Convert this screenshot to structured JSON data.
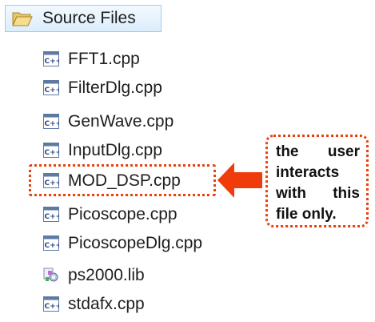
{
  "tree": {
    "folder": {
      "label": "Source Files",
      "icon": "open-folder-icon"
    },
    "files": [
      {
        "label": "FFT1.cpp",
        "icon": "cpp-file-icon"
      },
      {
        "label": "FilterDlg.cpp",
        "icon": "cpp-file-icon"
      },
      {
        "label": "GenWave.cpp",
        "icon": "cpp-file-icon"
      },
      {
        "label": "InputDlg.cpp",
        "icon": "cpp-file-icon"
      },
      {
        "label": "MOD_DSP.cpp",
        "icon": "cpp-file-icon"
      },
      {
        "label": "Picoscope.cpp",
        "icon": "cpp-file-icon"
      },
      {
        "label": "PicoscopeDlg.cpp",
        "icon": "cpp-file-icon"
      },
      {
        "label": "ps2000.lib",
        "icon": "lib-file-icon"
      },
      {
        "label": "stdafx.cpp",
        "icon": "cpp-file-icon"
      }
    ]
  },
  "annotation": {
    "lines": [
      "the user",
      "interacts",
      "with this",
      "file only."
    ],
    "color": "#e8410e",
    "highlighted_file": "MOD_DSP.cpp"
  }
}
